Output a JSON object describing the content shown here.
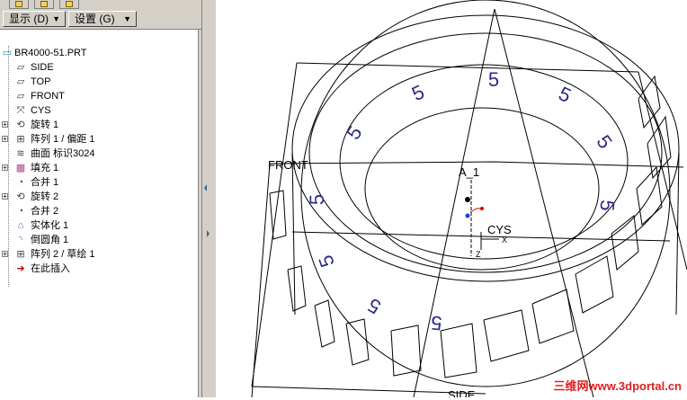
{
  "menu": {
    "display_label": "显示 (D)",
    "settings_label": "设置 (G)"
  },
  "tree": {
    "items": [
      {
        "label": "BR4000-51.PRT",
        "icon": "part-icon",
        "expandable": false
      },
      {
        "label": "SIDE",
        "icon": "datum-plane-icon",
        "expandable": false
      },
      {
        "label": "TOP",
        "icon": "datum-plane-icon",
        "expandable": false
      },
      {
        "label": "FRONT",
        "icon": "datum-plane-icon",
        "expandable": false
      },
      {
        "label": "CYS",
        "icon": "coordinate-system-icon",
        "expandable": false
      },
      {
        "label": "旋转 1",
        "icon": "revolve-icon",
        "expandable": true
      },
      {
        "label": "阵列 1 / 偏距 1",
        "icon": "pattern-icon",
        "expandable": true
      },
      {
        "label": "曲面 标识3024",
        "icon": "surface-icon",
        "expandable": false
      },
      {
        "label": "填充 1",
        "icon": "fill-icon",
        "expandable": true
      },
      {
        "label": "合并 1",
        "icon": "merge-icon",
        "expandable": false
      },
      {
        "label": "旋转 2",
        "icon": "revolve-icon",
        "expandable": true
      },
      {
        "label": "合并 2",
        "icon": "merge-icon",
        "expandable": false
      },
      {
        "label": "实体化 1",
        "icon": "solidify-icon",
        "expandable": false
      },
      {
        "label": "倒圆角 1",
        "icon": "round-icon",
        "expandable": false
      },
      {
        "label": "阵列 2 / 草绘 1",
        "icon": "pattern-icon",
        "expandable": true
      },
      {
        "label": "在此插入",
        "icon": "insert-here-arrow-icon",
        "expandable": false
      }
    ]
  },
  "viewport": {
    "labels": {
      "front": "FRONT",
      "axis": "A_1",
      "cys": "CYS",
      "x": "X",
      "z": "Z",
      "side": "SIDE"
    },
    "digit": "5",
    "watermark": "三维网www.3dportal.cn"
  },
  "colors": {
    "digit": "#2a2a8a",
    "watermark": "#e02020",
    "insert_arrow": "#cc0000"
  }
}
